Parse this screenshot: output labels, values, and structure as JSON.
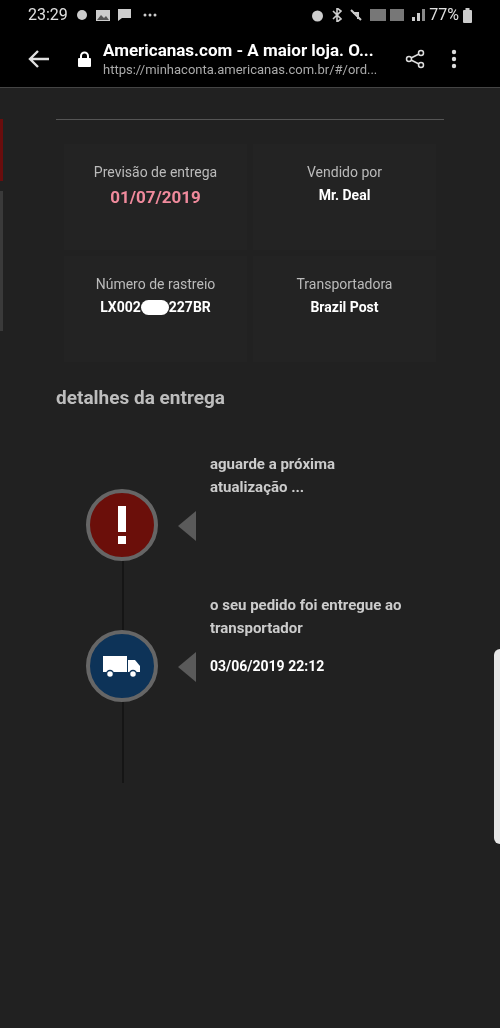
{
  "status_bar": {
    "time": "23:29",
    "battery": "77%"
  },
  "browser": {
    "title": "Americanas.com - A maior loja. O...",
    "url": "https://minhaconta.americanas.com.br/#/ord..."
  },
  "info": [
    {
      "label": "Previsão de entrega",
      "value": "01/07/2019",
      "kind": "highlight"
    },
    {
      "label": "Vendido por",
      "value": "Mr. Deal",
      "kind": "plain"
    },
    {
      "label": "Número de rastreio",
      "value_parts": [
        "LX002",
        "227BR"
      ],
      "kind": "redacted"
    },
    {
      "label": "Transportadora",
      "value": "Brazil Post",
      "kind": "plain"
    }
  ],
  "section_title": "detalhes da entrega",
  "events": [
    {
      "kind": "alert",
      "text": "aguarde a próxima atualização ..."
    },
    {
      "kind": "truck",
      "text": "o seu pedido foi entregue ao transportador",
      "date": "03/06/2019 22:12"
    }
  ]
}
